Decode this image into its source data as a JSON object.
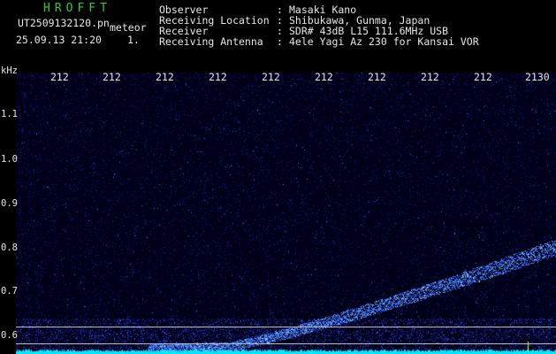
{
  "header": {
    "app_title": "HROFFT",
    "file_name": "UT2509132120.pn",
    "file_tag": "meteor",
    "date_time": "25.09.13 21:20",
    "count": "1."
  },
  "station_info": [
    {
      "label": "Observer",
      "sep": ":",
      "value": "Masaki Kano"
    },
    {
      "label": "Receiving Location",
      "sep": ":",
      "value": "Shibukawa, Gunma, Japan"
    },
    {
      "label": "Receiver",
      "sep": ":",
      "value": "SDR# 43dB L15 111.6MHz USB"
    },
    {
      "label": "Receiving Antenna",
      "sep": ":",
      "value": "4ele Yagi Az 230 for Kansai VOR"
    }
  ],
  "time_axis": {
    "ticks": [
      "212",
      "212",
      "212",
      "212",
      "212",
      "212",
      "212",
      "212",
      "212",
      "2130"
    ]
  },
  "freq_axis": {
    "unit": "kHz",
    "ticks": [
      "1.1",
      "1.0",
      "0.9",
      "0.8",
      "0.7",
      "0.6"
    ]
  },
  "colors": {
    "background": "#000000",
    "title": "#33cc33",
    "text": "#e8e8e8",
    "noise": "#1a2aa0",
    "signal": "#5aa0ff",
    "baseline": "#00ffff",
    "marker": "#ffff00"
  }
}
